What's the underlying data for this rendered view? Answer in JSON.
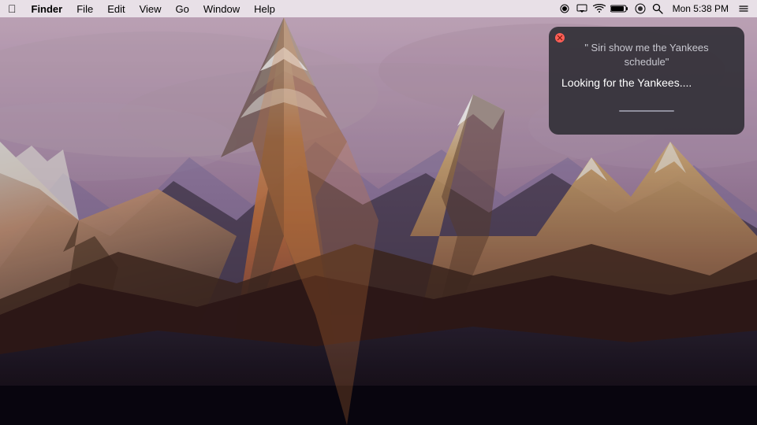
{
  "menubar": {
    "apple_label": "",
    "items": [
      {
        "label": "Finder",
        "bold": true
      },
      {
        "label": "File"
      },
      {
        "label": "Edit"
      },
      {
        "label": "View"
      },
      {
        "label": "Go"
      },
      {
        "label": "Window"
      },
      {
        "label": "Help"
      }
    ],
    "status_icons": [
      {
        "name": "record-icon",
        "symbol": "⏺"
      },
      {
        "name": "airplay-icon",
        "symbol": "▭"
      },
      {
        "name": "wifi-icon",
        "symbol": "◟◜"
      },
      {
        "name": "battery-icon",
        "symbol": "▬"
      },
      {
        "name": "siri-icon",
        "symbol": "◉"
      },
      {
        "name": "search-icon",
        "symbol": "⌕"
      },
      {
        "name": "notification-icon",
        "symbol": "≡"
      }
    ],
    "time": "Mon 5:38 PM"
  },
  "siri": {
    "query": "\" Siri show me the Yankees schedule\"",
    "status": "Looking for the Yankees....",
    "close_button": "×"
  },
  "desktop": {
    "wallpaper_description": "macOS Sierra mountain wallpaper"
  }
}
